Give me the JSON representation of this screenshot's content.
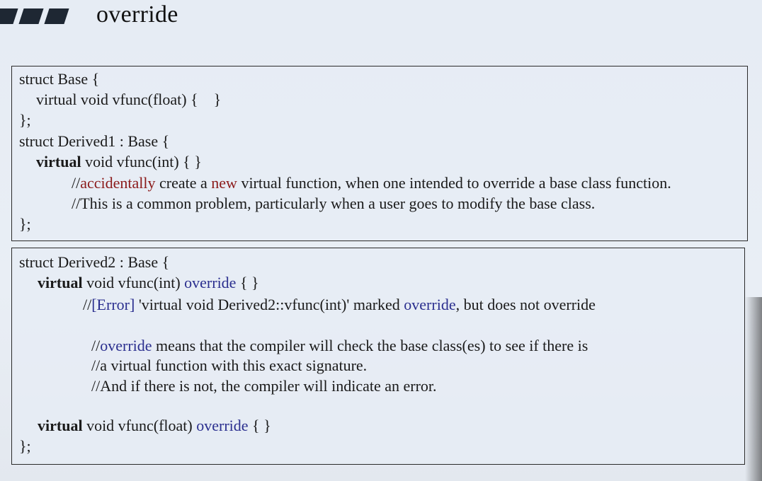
{
  "header": {
    "title": "override"
  },
  "box1": {
    "l1": "struct Base {",
    "l2": "virtual void vfunc(float) {    }",
    "l3": "};",
    "l4": "struct Derived1 : Base {",
    "l5_kw": "virtual",
    "l5_rest": " void vfunc(int) { }",
    "l6_a": "//",
    "l6_b": "accidentally",
    "l6_c": " create a ",
    "l6_d": "new",
    "l6_e": " virtual function, when one intended to override a base class function.",
    "l7": "//This is a common problem, particularly when a user goes to modify the base class.",
    "l8": "};"
  },
  "box2": {
    "l1": "struct Derived2 : Base {",
    "l2_kw": "virtual",
    "l2_mid": " void vfunc(int) ",
    "l2_ovr": "override",
    "l2_end": " { }",
    "l3_a": "//",
    "l3_b": "[Error]",
    "l3_c": " 'virtual void Derived2::vfunc(int)' marked ",
    "l3_d": "override",
    "l3_e": ", but does not override",
    "l4_a": "//",
    "l4_b": "override",
    "l4_c": " means that the compiler will check the base class(es) to see if there is",
    "l5": "//a virtual function with this exact signature.",
    "l6": "//And if there is not, the compiler will indicate an error.",
    "l7_kw": "virtual",
    "l7_mid": " void vfunc(float) ",
    "l7_ovr": "override",
    "l7_end": " { }",
    "l8": "};"
  },
  "colors": {
    "override": "#2b2f8f",
    "highlight": "#8b1a1a"
  }
}
